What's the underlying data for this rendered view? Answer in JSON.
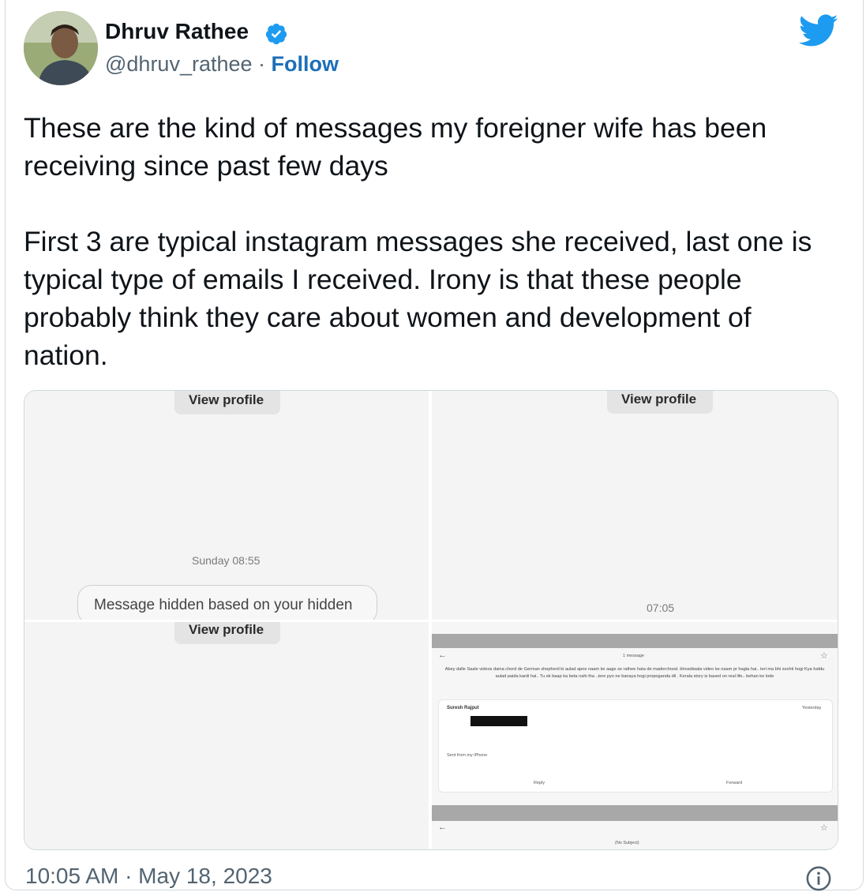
{
  "author": {
    "name": "Dhruv Rathee",
    "handle": "@dhruv_rathee",
    "separator": " · ",
    "follow_label": "Follow"
  },
  "tweet": {
    "paragraph1": "These are the kind of messages my foreigner wife has been receiving since past few days",
    "paragraph2": "First 3 are typical instagram messages she received, last one is typical type of emails I received. Irony is that these people probably think they care about women and development of nation."
  },
  "media": {
    "tile1": {
      "view_profile": "View profile",
      "timestamp": "Sunday 08:55",
      "bubble_text": "Message hidden based on your hidden"
    },
    "tile2": {
      "view_profile": "View profile",
      "timestamp": "07:05"
    },
    "tile3": {
      "view_profile": "View profile"
    },
    "tile4": {
      "thread_count": "1 message",
      "email_text": "Abey dalle Saale videos daina chord de German shepherd ki aulad apne naam ke aage se rathee hata de maderchood. bhosdiwala video ke naam pr hagta hai.. teri ma bhi sochti hogi Kya fuddu aulad paida kardi hai.. Tu ek baap ka beta nahi tha ..tere pyo ne banaya hogi propoganda dil . Kerala story is based on real life.. behan ke lode",
      "sender": "Suresh Rajput",
      "signature": "Sent from my iPhone",
      "reply_label": "Reply",
      "forward_label": "Forward",
      "time_label": "Yesterday",
      "subject": "(No Subject)"
    }
  },
  "footer": {
    "timestamp": "10:05 AM · May 18, 2023"
  },
  "colors": {
    "link": "#1d6fb8",
    "twitter_blue": "#1d9bf0",
    "muted": "#536471"
  }
}
